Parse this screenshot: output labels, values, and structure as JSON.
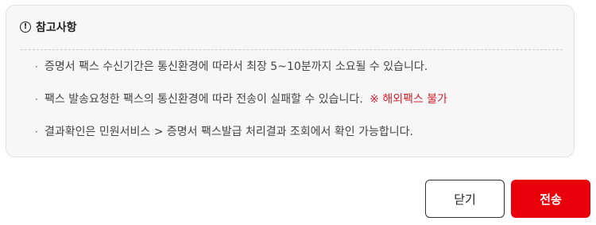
{
  "notice": {
    "icon": "exclamation-circle-icon",
    "title": "참고사항",
    "items": [
      {
        "text": "증명서 팩스 수신기간은 통신환경에 따라서 최장 5~10분까지 소요될 수 있습니다.",
        "warning": ""
      },
      {
        "text": "팩스 발송요청한 팩스의 통신환경에 따라 전송이 실패할 수 있습니다.",
        "warning": "※ 해외팩스 불가"
      },
      {
        "text": "결과확인은 민원서비스 > 증명서 팩스발급 처리결과 조회에서 확인 가능합니다.",
        "warning": ""
      }
    ]
  },
  "buttons": {
    "close_label": "닫기",
    "send_label": "전송"
  },
  "colors": {
    "warning": "#d1242f",
    "primary": "#e8000b",
    "box_bg": "#f7f7f7"
  }
}
